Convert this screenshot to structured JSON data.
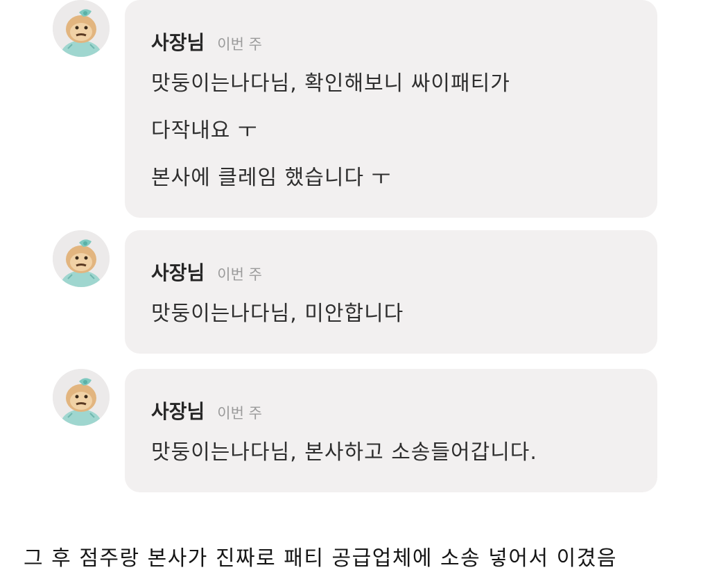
{
  "reviews": [
    {
      "author": "사장님",
      "time": "이번 주",
      "lines": [
        "맛둥이는나다님, 확인해보니 싸이패티가",
        "다작내요 ㅜ",
        "본사에 클레임 했습니다 ㅜ"
      ]
    },
    {
      "author": "사장님",
      "time": "이번 주",
      "lines": [
        "맛둥이는나다님, 미안합니다"
      ]
    },
    {
      "author": "사장님",
      "time": "이번 주",
      "lines": [
        "맛둥이는나다님, 본사하고 소송들어갑니다."
      ]
    }
  ],
  "caption": "그 후 점주랑 본사가 진짜로 패티 공급업체에 소송 넣어서 이겼음"
}
